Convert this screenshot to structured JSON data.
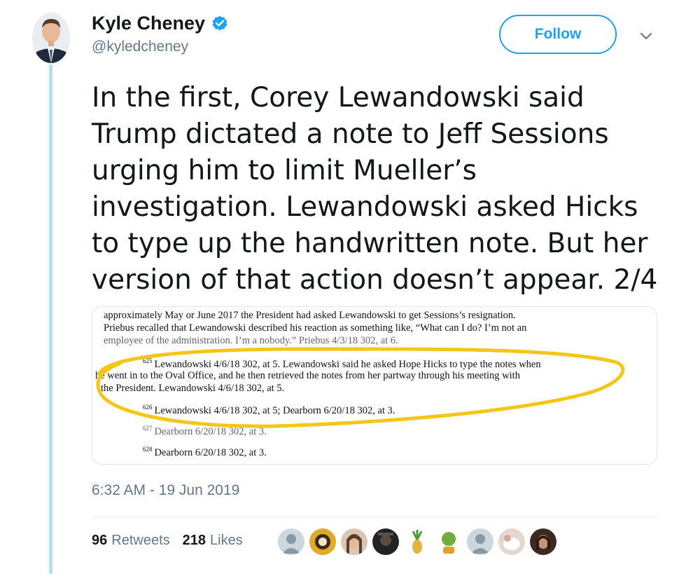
{
  "author": {
    "display_name": "Kyle Cheney",
    "handle": "@kyledcheney"
  },
  "follow_label": "Follow",
  "tweet_text": "In the first, Corey Lewandowski said\nTrump dictated a note to Jeff Sessions\nurging him to limit Mueller’s\ninvestigation. Lewandowski asked Hicks\nto type up the handwritten note. But her\nversion of that action doesn’t appear. 2/4",
  "document": {
    "lines": [
      "approximately May or June 2017 the President had asked Lewandowski to get Sessions’s resignation.",
      "Priebus recalled that Lewandowski described his reaction as something like, “What can I do? I’m not an",
      "employee of the administration. I’m a nobody.” Priebus 4/3/18 302, at 6."
    ],
    "footnotes": [
      {
        "num": "625",
        "lines": [
          "Lewandowski 4/6/18 302, at 5. Lewandowski said he asked Hope Hicks to type the notes when",
          "he went in to the Oval Office, and he then retrieved the notes from her partway through his meeting with",
          "the President. Lewandowski 4/6/18 302, at 5."
        ]
      },
      {
        "num": "626",
        "lines": [
          "Lewandowski 4/6/18 302, at 5; Dearborn 6/20/18 302, at 3."
        ]
      },
      {
        "num": "627",
        "lines": [
          "Dearborn 6/20/18 302, at 3."
        ]
      },
      {
        "num": "628",
        "lines": [
          "Dearborn 6/20/18 302, at 3."
        ]
      }
    ],
    "highlight_color": "#f5c518"
  },
  "timestamp": "6:32 AM - 19 Jun 2019",
  "stats": {
    "retweets_count": "96",
    "retweets_label": "Retweets",
    "likes_count": "218",
    "likes_label": "Likes"
  },
  "colors": {
    "accent": "#1da1f2",
    "thread_line": "#b8dcf3",
    "muted_text": "#657786"
  }
}
